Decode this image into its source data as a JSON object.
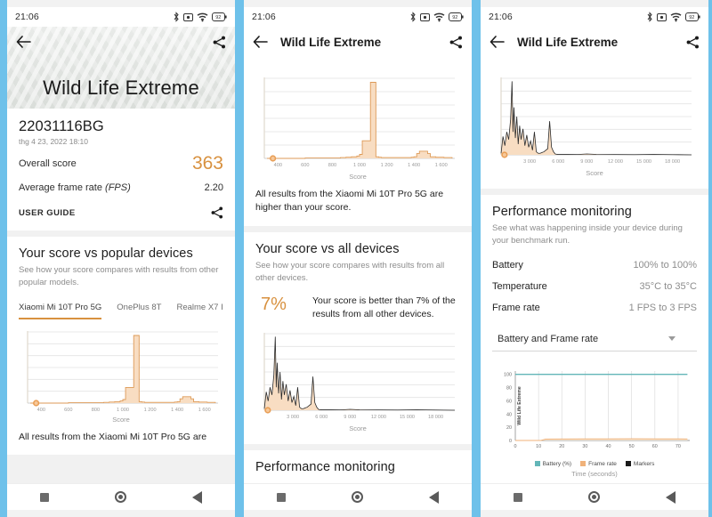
{
  "theme": {
    "background": "#6ec1ea",
    "accent": "#d8913f",
    "card": "#ffffff",
    "muted": "#8d8d8d",
    "battery_color": "#63b6b8",
    "framerate_color": "#f0b27a",
    "markers_color": "#1a1a1a"
  },
  "status_bar": {
    "time": "21:06",
    "icons": [
      "bluetooth-icon",
      "alarm-icon",
      "wifi-icon",
      "battery-icon"
    ]
  },
  "nav_bar": {
    "recents": "recents-square-icon",
    "home": "home-circle-icon",
    "back": "back-triangle-icon"
  },
  "screen1": {
    "appbar": {
      "back": "back-arrow-icon",
      "share": "share-icon"
    },
    "hero_title": "Wild Life Extreme",
    "result": {
      "device_name": "22031116BG",
      "date": "thg 4 23, 2022 18:10",
      "overall_score_label": "Overall score",
      "overall_score": "363",
      "avg_frame_rate_label": "Average frame rate",
      "avg_frame_rate_label_italic": "(FPS)",
      "avg_frame_rate": "2.20",
      "user_guide": "USER GUIDE"
    },
    "popular": {
      "title": "Your score vs popular devices",
      "subtitle": "See how your score compares with results from other popular models.",
      "tabs": [
        {
          "label": "Xiaomi Mi 10T Pro 5G",
          "active": true
        },
        {
          "label": "OnePlus 8T",
          "active": false
        },
        {
          "label": "Realme X7 I",
          "active": false
        }
      ],
      "caption_partial": "All results from the Xiaomi Mi 10T Pro 5G are"
    }
  },
  "screen2": {
    "appbar": {
      "back": "back-arrow-icon",
      "title": "Wild Life Extreme",
      "share": "share-icon"
    },
    "popular_caption": "All results from the Xiaomi Mi 10T Pro 5G are higher than your score.",
    "all_devices": {
      "title": "Your score vs all devices",
      "subtitle": "See how your score compares with results from all other devices.",
      "percent": "7%",
      "percent_text": "Your score is better than 7% of the results from all other devices."
    },
    "perf_title_partial": "Performance monitoring"
  },
  "screen3": {
    "appbar": {
      "back": "back-arrow-icon",
      "title": "Wild Life Extreme",
      "share": "share-icon"
    },
    "performance": {
      "title": "Performance monitoring",
      "subtitle": "See what was happening inside your device during your benchmark run.",
      "rows": [
        {
          "key": "Battery",
          "value": "100% to 100%"
        },
        {
          "key": "Temperature",
          "value": "35°C to 35°C"
        },
        {
          "key": "Frame rate",
          "value": "1 FPS to 3 FPS"
        }
      ],
      "select_value": "Battery and Frame rate",
      "select_icon": "chevron-down-icon"
    }
  },
  "chart_data": [
    {
      "id": "popular-histogram",
      "type": "area",
      "title": "Your score vs popular devices",
      "xlabel": "Score",
      "ylabel": "",
      "xlim": [
        300,
        1700
      ],
      "ylim": [
        0,
        100
      ],
      "grid": true,
      "xticks": [
        400,
        600,
        800,
        1000,
        1200,
        1400,
        1600
      ],
      "xticklabels": [
        "400",
        "600",
        "800",
        "1 000",
        "1 200",
        "1 400",
        "1 600"
      ],
      "marker": {
        "label": "Your score",
        "x": 363,
        "y": 0,
        "color": "#e89a4e"
      },
      "x": [
        320,
        400,
        500,
        600,
        700,
        800,
        860,
        900,
        940,
        980,
        1000,
        1020,
        1040,
        1060,
        1080,
        1100,
        1120,
        1140,
        1160,
        1200,
        1260,
        1320,
        1380,
        1400,
        1420,
        1440,
        1470,
        1500,
        1520,
        1560,
        1620,
        1680
      ],
      "values": [
        0,
        0,
        0,
        0.5,
        0.5,
        0.5,
        1,
        1.5,
        2,
        3,
        5,
        22,
        22,
        22,
        95,
        95,
        2,
        1.5,
        1,
        1,
        1,
        1,
        1.5,
        2,
        6,
        9,
        9,
        6,
        2,
        1.5,
        1,
        0
      ]
    },
    {
      "id": "all-devices-histogram",
      "type": "area",
      "title": "Your score vs all devices",
      "xlabel": "Score",
      "ylabel": "",
      "xlim": [
        0,
        20000
      ],
      "ylim": [
        0,
        100
      ],
      "grid": true,
      "xticks": [
        3000,
        6000,
        9000,
        12000,
        15000,
        18000
      ],
      "xticklabels": [
        "3 000",
        "6 000",
        "9 000",
        "12 000",
        "15 000",
        "18 000"
      ],
      "marker": {
        "label": "Your score",
        "x": 363,
        "y": 0,
        "color": "#e89a4e"
      },
      "x": [
        0,
        200,
        400,
        600,
        800,
        1000,
        1150,
        1250,
        1350,
        1500,
        1650,
        1800,
        1950,
        2100,
        2300,
        2500,
        2700,
        2900,
        3100,
        3300,
        3500,
        3700,
        3900,
        4100,
        4300,
        4500,
        4700,
        4900,
        5100,
        5300,
        5500,
        5700,
        6000,
        6500,
        7000,
        8000,
        9000,
        10000,
        12000,
        14000,
        16000,
        18000,
        20000
      ],
      "values": [
        2,
        24,
        12,
        30,
        20,
        46,
        96,
        30,
        62,
        22,
        50,
        14,
        38,
        20,
        34,
        12,
        26,
        10,
        18,
        6,
        30,
        4,
        2,
        2,
        3,
        4,
        6,
        8,
        44,
        10,
        4,
        1,
        0.5,
        0.5,
        0.5,
        0.4,
        1.2,
        0.6,
        0.4,
        0.3,
        0.6,
        0.3,
        0
      ]
    },
    {
      "id": "performance-monitoring",
      "type": "line",
      "title": "Performance monitoring",
      "xlabel": "Time (seconds)",
      "ylabel": "Wild Life Extreme",
      "xlim": [
        0,
        75
      ],
      "ylim": [
        0,
        105
      ],
      "grid": true,
      "xticks": [
        0,
        10,
        20,
        30,
        40,
        50,
        60,
        70
      ],
      "xticklabels": [
        "0",
        "10",
        "20",
        "30",
        "40",
        "50",
        "60",
        "70"
      ],
      "yticks": [
        0,
        20,
        40,
        60,
        80,
        100
      ],
      "yticklabels": [
        "0",
        "20",
        "40",
        "60",
        "80",
        "100"
      ],
      "legend_position": "bottom",
      "series": [
        {
          "name": "Battery (%)",
          "color": "#63b6b8",
          "x": [
            0,
            10,
            20,
            30,
            40,
            50,
            60,
            70,
            74
          ],
          "values": [
            100,
            100,
            100,
            100,
            100,
            100,
            100,
            100,
            100
          ]
        },
        {
          "name": "Frame rate",
          "color": "#f0b27a",
          "x": [
            0,
            11,
            13,
            20,
            30,
            40,
            50,
            60,
            70,
            74
          ],
          "values": [
            0,
            0,
            2,
            2.2,
            2.4,
            2.3,
            2.6,
            2.4,
            2.3,
            2.2
          ]
        },
        {
          "name": "Markers",
          "color": "#1a1a1a",
          "x": [],
          "values": []
        }
      ]
    }
  ]
}
